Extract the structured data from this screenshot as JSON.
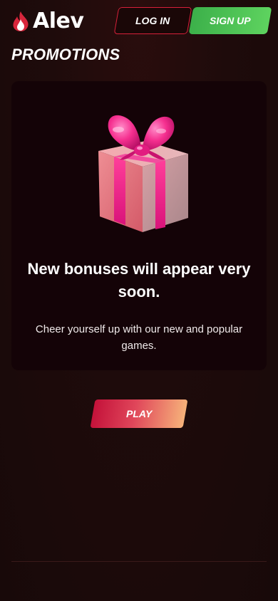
{
  "header": {
    "logo_text": "Alev",
    "login_label": "LOG IN",
    "signup_label": "SIGN UP"
  },
  "page": {
    "title": "PROMOTIONS"
  },
  "promo": {
    "image_icon": "gift-box-icon",
    "heading": "New bonuses will appear very soon.",
    "subtext": "Cheer yourself up with our new and popular games.",
    "play_label": "PLAY"
  },
  "colors": {
    "background": "#1e0b0b",
    "card": "#140307",
    "login_border": "#d8203a",
    "signup_green": "#4fc255",
    "play_start": "#c4123a",
    "play_end": "#f6b27a"
  }
}
